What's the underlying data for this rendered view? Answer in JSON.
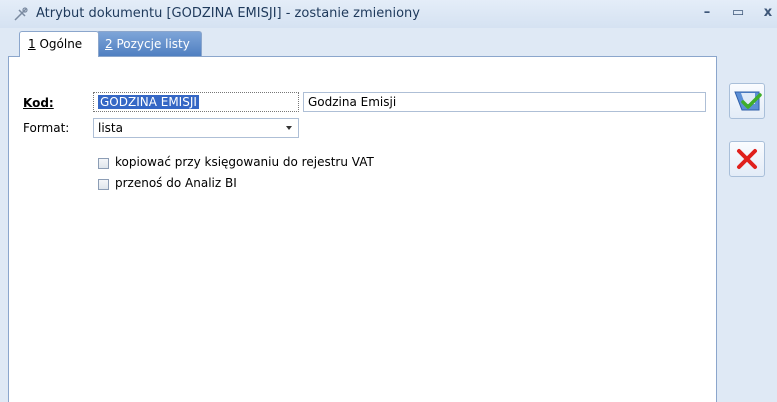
{
  "window": {
    "title": "Atrybut dokumentu [GODZINA EMISJI] - zostanie zmieniony",
    "minimize_glyph": "–",
    "maximize_glyph": "▭",
    "close_glyph": "x"
  },
  "tabs": [
    {
      "hotkey": "1",
      "label": " Ogólne",
      "active": true
    },
    {
      "hotkey": "2",
      "label": " Pozycje listy",
      "active": false
    }
  ],
  "form": {
    "code_label": "Kod:",
    "code_value": "GODZINA EMISJI",
    "name_value": "Godzina Emisji",
    "format_label": "Format:",
    "format_value": "lista",
    "checkboxes": [
      {
        "label": "kopiować przy księgowaniu do rejestru VAT",
        "checked": false
      },
      {
        "label": "przenoś do Analiz BI",
        "checked": false
      }
    ]
  },
  "sidebar": {
    "save_icon": "save-icon",
    "cancel_icon": "cancel-x-icon"
  },
  "colors": {
    "accent": "#3567c5",
    "cancel": "#e0201c",
    "save_check": "#3fae2a"
  }
}
